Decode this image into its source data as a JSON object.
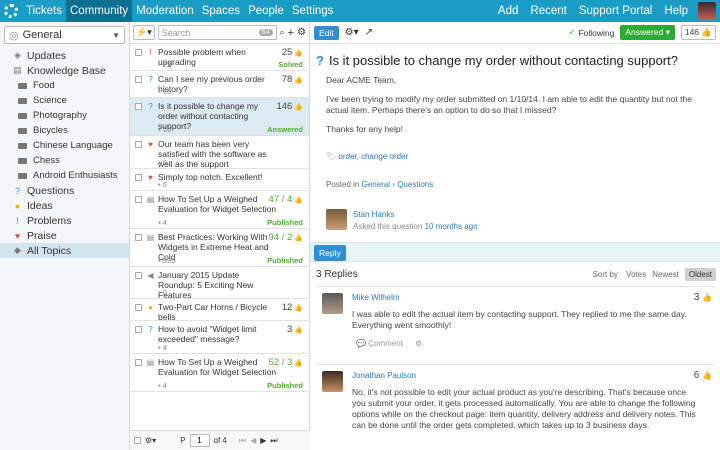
{
  "topnav": {
    "items": [
      "Tickets",
      "Community",
      "Moderation",
      "Spaces",
      "People",
      "Settings"
    ],
    "active": "Community",
    "right": [
      "Add",
      "Recent",
      "Support Portal",
      "Help"
    ]
  },
  "sidebar": {
    "space": "General",
    "items": [
      {
        "label": "Updates",
        "icon": "updates-icon"
      },
      {
        "label": "Knowledge Base",
        "icon": "knowledge-base-icon"
      },
      {
        "label": "Food",
        "sub": true
      },
      {
        "label": "Science",
        "sub": true
      },
      {
        "label": "Photography",
        "sub": true
      },
      {
        "label": "Bicycles",
        "sub": true
      },
      {
        "label": "Chinese Language",
        "sub": true
      },
      {
        "label": "Chess",
        "sub": true
      },
      {
        "label": "Android Enthusiasts",
        "sub": true
      },
      {
        "label": "Questions",
        "icon": "question-icon"
      },
      {
        "label": "Ideas",
        "icon": "lightbulb-icon"
      },
      {
        "label": "Problems",
        "icon": "exclamation-icon"
      },
      {
        "label": "Praise",
        "icon": "heart-icon"
      },
      {
        "label": "All Topics",
        "icon": "layers-icon",
        "selected": true
      }
    ]
  },
  "list": {
    "search_placeholder": "Search",
    "search_count": "64",
    "rows": [
      {
        "title": "Possible problem when upgrading",
        "meta": "22",
        "votes": "25",
        "status": "Solved"
      },
      {
        "title": "Can I see my previous order history?",
        "meta": "13",
        "votes": "78"
      },
      {
        "title": "Is it possible to change my order without contacting support?",
        "meta": "16",
        "votes": "146",
        "status": "Answered",
        "selected": true
      },
      {
        "title": "Our team has been very satisfied with the software as well as the support",
        "meta": "8"
      },
      {
        "title": "Simply top notch. Excellent!",
        "meta": "6"
      },
      {
        "title": "How To Set Up a Weighed Evaluation for Widget Selection",
        "meta": "4",
        "votes": "47 / 4",
        "status": "Published"
      },
      {
        "title": "Best Practices: Working With Widgets in Extreme Heat and Cold",
        "meta": "895",
        "votes": "94 / 2",
        "status": "Published"
      },
      {
        "title": "January 2015 Update Roundup: 5 Exciting New Features",
        "meta": "0"
      },
      {
        "title": "Two-Part Car Horns / Bicycle bells",
        "meta": "",
        "votes": "12"
      },
      {
        "title": "How to avoid \"Widget limit exceeded\" message?",
        "meta": "4",
        "votes": "3"
      },
      {
        "title": "How To Set Up a Weighed Evaluation for Widget Selection",
        "meta": "4",
        "votes": "52 / 3",
        "status": "Published"
      }
    ],
    "footer": {
      "page_label": "P",
      "page": "1",
      "of": "of 4"
    }
  },
  "detail": {
    "toolbar": {
      "edit": "Edit",
      "following": "Following",
      "answered": "Answered",
      "votes": "146"
    },
    "title": "Is it possible to change my order without contacting support?",
    "body": [
      "Dear ACME Team,",
      "I've been trying to modify my order submitted on 1/10/14. I am able to edit the quantity but not the actual item. Perhaps there's an option to do so that I missed?",
      "Thanks for any help!"
    ],
    "tags": "order, change order",
    "posted_in_prefix": "Posted in",
    "posted_in_space": "General",
    "posted_in_sep": "›",
    "posted_in_topic": "Questions",
    "asker_name": "Stan Hanks",
    "asker_sub": "Asked this question",
    "asker_time": "10 months ago",
    "reply_button": "Reply",
    "replies_title": "3 Replies",
    "sort_label": "Sort by:",
    "sort_options": [
      "Votes",
      "Newest",
      "Oldest"
    ],
    "replies": [
      {
        "name": "Mike Wilhelm",
        "text": "I was able to edit the actual item by contacting support. They replied to me the same day. Everything went smoothly!",
        "votes": "3",
        "action": "Comment"
      },
      {
        "name": "Jonathan Paulson",
        "text": "No, it's not possible to edit your actual product as you're describing. That's because once you submit your order, it gets processed automatically. You are able to change the following options while on the checkout page: item quantity, delivery address and delivery notes. This can be done until the order gets completed, which takes up to 3 business days.",
        "votes": "6"
      }
    ]
  },
  "colors": {
    "brand": "#1a9cc4",
    "accent": "#2f8fd0",
    "success": "#2daa33"
  }
}
